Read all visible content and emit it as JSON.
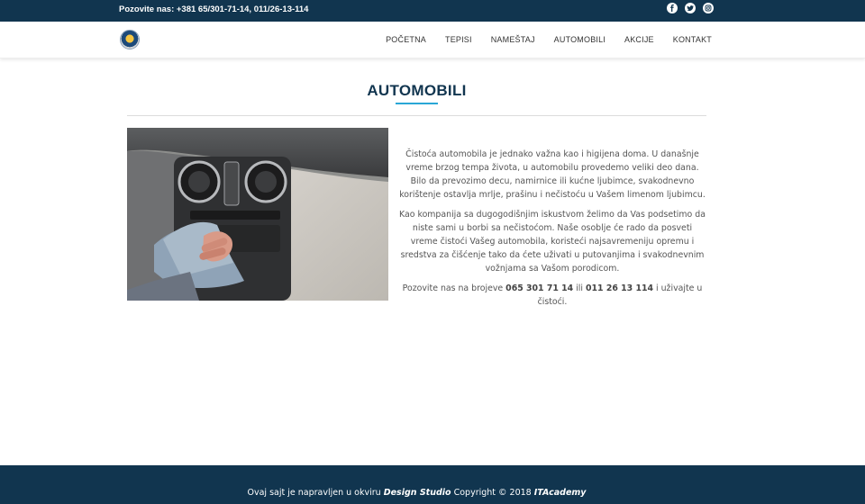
{
  "topbar": {
    "phone": "Pozovite nas: +381 65/301-71-14, 011/26-13-114",
    "social": [
      "facebook-icon",
      "twitter-icon",
      "instagram-icon"
    ]
  },
  "nav": {
    "items": [
      "POČETNA",
      "TEPISI",
      "NAMEŠTAJ",
      "AUTOMOBILI",
      "AKCIJE",
      "KONTAKT"
    ]
  },
  "main": {
    "title": "AUTOMOBILI",
    "paragraph1": "Čistoća automobila je jednako važna kao i higijena doma. U današnje vreme brzog tempa života, u automobilu provedemo veliki deo dana. Bilo da prevozimo decu, namirnice ili kućne ljubimce, svakodnevno korištenje ostavlja mrlje, prašinu i nečistoću u Vašem limenom ljubimcu.",
    "paragraph2": "Kao kompanija sa dugogodišnjim iskustvom želimo da Vas podsetimo da niste sami u borbi sa nečistoćom. Naše osoblje će rado da posveti vreme čistoći Vašeg automobila, koristeći najsavremeniju opremu i sredstva za čišćenje tako da ćete uživati u putovanjima i svakodnevnim vožnjama sa Vašom porodicom.",
    "call_prefix": "Pozovite nas na brojeve",
    "phone1": "065 301 71 14",
    "call_or": "ili",
    "phone2": "011 26 13 114",
    "call_suffix": "i uživajte u čistoći."
  },
  "footer": {
    "prefix": "Ovaj sajt je napravljen u okviru",
    "brand1": "Design Studio",
    "middle": "Copyright © 2018",
    "brand2": "ITAcademy"
  },
  "colors": {
    "brand_dark": "#11354f",
    "accent": "#29a7d6"
  }
}
